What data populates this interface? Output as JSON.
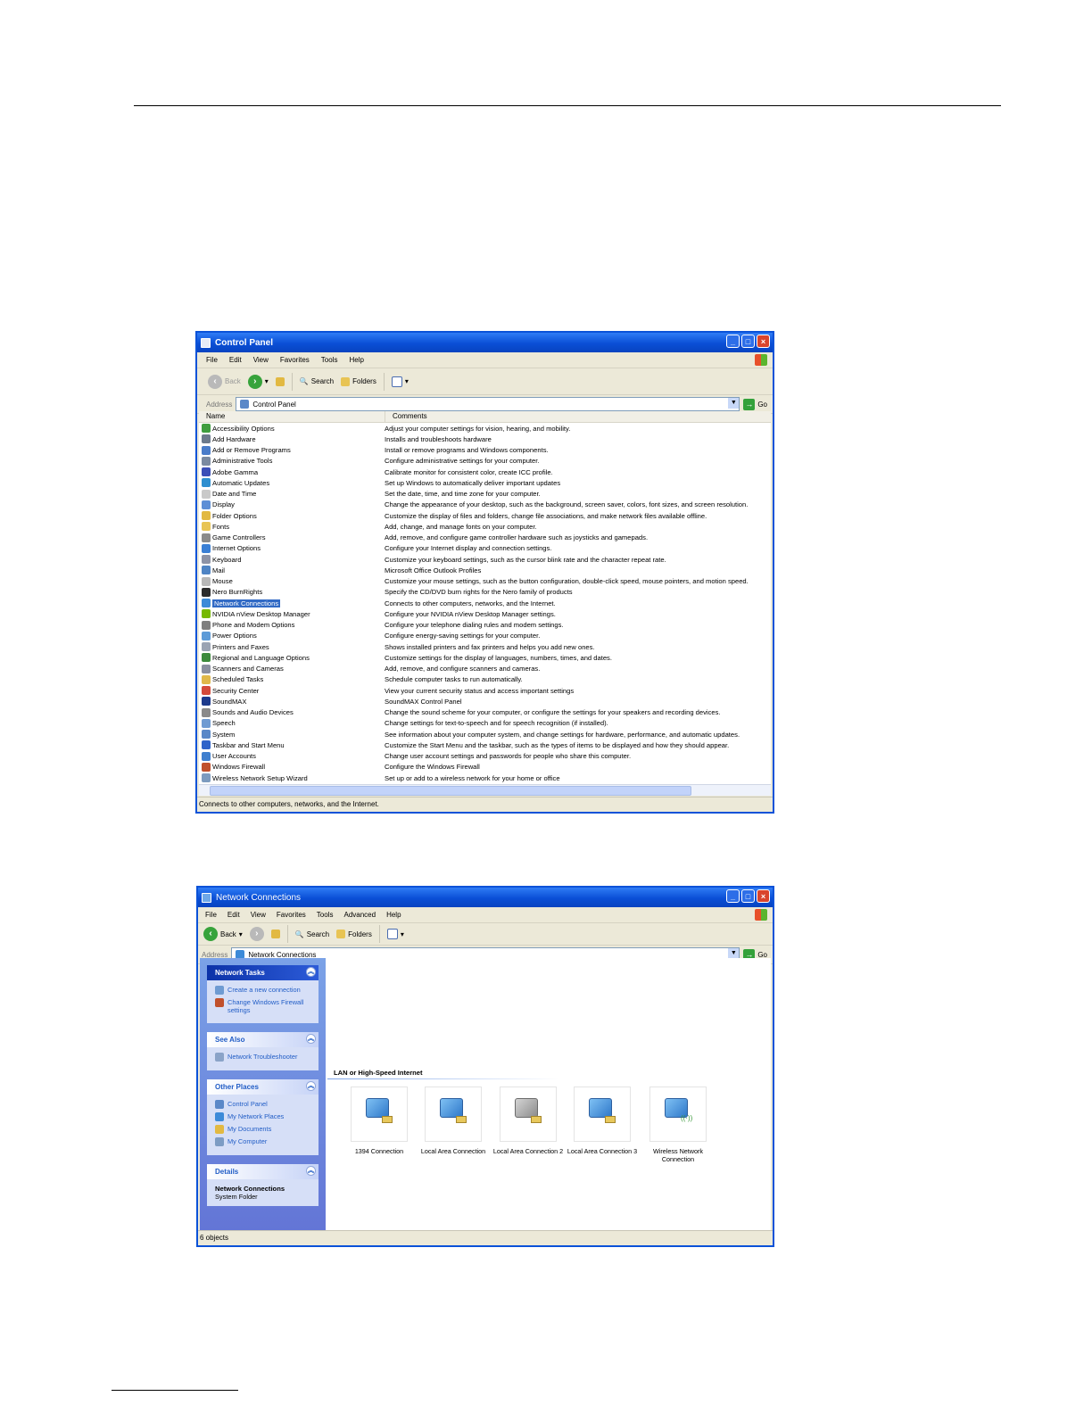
{
  "control_panel": {
    "title": "Control Panel",
    "menu": [
      "File",
      "Edit",
      "View",
      "Favorites",
      "Tools",
      "Help"
    ],
    "toolbar": {
      "back": "Back",
      "search": "Search",
      "folders": "Folders"
    },
    "address_label": "Address",
    "address_value": "Control Panel",
    "go": "Go",
    "columns": {
      "name": "Name",
      "comments": "Comments"
    },
    "items": [
      {
        "name": "Accessibility Options",
        "comment": "Adjust your computer settings for vision, hearing, and mobility.",
        "color": "#3f9d3f"
      },
      {
        "name": "Add Hardware",
        "comment": "Installs and troubleshoots hardware",
        "color": "#6c7a8c"
      },
      {
        "name": "Add or Remove Programs",
        "comment": "Install or remove programs and Windows components.",
        "color": "#4a7cc9"
      },
      {
        "name": "Administrative Tools",
        "comment": "Configure administrative settings for your computer.",
        "color": "#7b8aa0"
      },
      {
        "name": "Adobe Gamma",
        "comment": "Calibrate monitor for consistent color, create ICC profile.",
        "color": "#3b4fb8"
      },
      {
        "name": "Automatic Updates",
        "comment": "Set up Windows to automatically deliver important updates",
        "color": "#2f8fd0"
      },
      {
        "name": "Date and Time",
        "comment": "Set the date, time, and time zone for your computer.",
        "color": "#c9c9c9"
      },
      {
        "name": "Display",
        "comment": "Change the appearance of your desktop, such as the background, screen saver, colors, font sizes, and screen resolution.",
        "color": "#5e8fd6"
      },
      {
        "name": "Folder Options",
        "comment": "Customize the display of files and folders, change file associations, and make network files available offline.",
        "color": "#e2b942"
      },
      {
        "name": "Fonts",
        "comment": "Add, change, and manage fonts on your computer.",
        "color": "#e8c454"
      },
      {
        "name": "Game Controllers",
        "comment": "Add, remove, and configure game controller hardware such as joysticks and gamepads.",
        "color": "#8b8b8b"
      },
      {
        "name": "Internet Options",
        "comment": "Configure your Internet display and connection settings.",
        "color": "#3a7fd5"
      },
      {
        "name": "Keyboard",
        "comment": "Customize your keyboard settings, such as the cursor blink rate and the character repeat rate.",
        "color": "#8d93a6"
      },
      {
        "name": "Mail",
        "comment": "Microsoft Office Outlook Profiles",
        "color": "#4f84c4"
      },
      {
        "name": "Mouse",
        "comment": "Customize your mouse settings, such as the button configuration, double-click speed, mouse pointers, and motion speed.",
        "color": "#b8b8b8"
      },
      {
        "name": "Nero BurnRights",
        "comment": "Specify the CD/DVD burn rights for the Nero family of products",
        "color": "#2b2b2b"
      },
      {
        "name": "Network Connections",
        "comment": "Connects to other computers, networks, and the Internet.",
        "color": "#3c8ad8",
        "selected": true
      },
      {
        "name": "NVIDIA nView Desktop Manager",
        "comment": "Configure your NVIDIA nView Desktop Manager settings.",
        "color": "#76b900"
      },
      {
        "name": "Phone and Modem Options",
        "comment": "Configure your telephone dialing rules and modem settings.",
        "color": "#7f7f7f"
      },
      {
        "name": "Power Options",
        "comment": "Configure energy-saving settings for your computer.",
        "color": "#5d9bd8"
      },
      {
        "name": "Printers and Faxes",
        "comment": "Shows installed printers and fax printers and helps you add new ones.",
        "color": "#9aa3b3"
      },
      {
        "name": "Regional and Language Options",
        "comment": "Customize settings for the display of languages, numbers, times, and dates.",
        "color": "#3c8a3c"
      },
      {
        "name": "Scanners and Cameras",
        "comment": "Add, remove, and configure scanners and cameras.",
        "color": "#8a8fa0"
      },
      {
        "name": "Scheduled Tasks",
        "comment": "Schedule computer tasks to run automatically.",
        "color": "#e0b84a"
      },
      {
        "name": "Security Center",
        "comment": "View your current security status and access important settings",
        "color": "#d44a3a"
      },
      {
        "name": "SoundMAX",
        "comment": "SoundMAX Control Panel",
        "color": "#1d3a8c"
      },
      {
        "name": "Sounds and Audio Devices",
        "comment": "Change the sound scheme for your computer, or configure the settings for your speakers and recording devices.",
        "color": "#8a8a8a"
      },
      {
        "name": "Speech",
        "comment": "Change settings for text-to-speech and for speech recognition (if installed).",
        "color": "#6f9bd2"
      },
      {
        "name": "System",
        "comment": "See information about your computer system, and change settings for hardware, performance, and automatic updates.",
        "color": "#5a88c8"
      },
      {
        "name": "Taskbar and Start Menu",
        "comment": "Customize the Start Menu and the taskbar, such as the types of items to be displayed and how they should appear.",
        "color": "#2f63c9"
      },
      {
        "name": "User Accounts",
        "comment": "Change user account settings and passwords for people who share this computer.",
        "color": "#3f7fcf"
      },
      {
        "name": "Windows Firewall",
        "comment": "Configure the Windows Firewall",
        "color": "#c0502c"
      },
      {
        "name": "Wireless Network Setup Wizard",
        "comment": "Set up or add to a wireless network for your home or office",
        "color": "#7c9bbf"
      }
    ],
    "status": "Connects to other computers, networks, and the Internet."
  },
  "network_connections": {
    "title": "Network Connections",
    "menu": [
      "File",
      "Edit",
      "View",
      "Favorites",
      "Tools",
      "Advanced",
      "Help"
    ],
    "toolbar": {
      "back": "Back",
      "search": "Search",
      "folders": "Folders"
    },
    "address_label": "Address",
    "address_value": "Network Connections",
    "go": "Go",
    "network_tasks": {
      "title": "Network Tasks",
      "items": [
        "Create a new connection",
        "Change Windows Firewall settings"
      ]
    },
    "see_also": {
      "title": "See Also",
      "items": [
        "Network Troubleshooter"
      ]
    },
    "other_places": {
      "title": "Other Places",
      "items": [
        "Control Panel",
        "My Network Places",
        "My Documents",
        "My Computer"
      ]
    },
    "details": {
      "title": "Details",
      "name": "Network Connections",
      "type": "System Folder"
    },
    "group_header": "LAN or High-Speed Internet",
    "connections": [
      {
        "label": "1394 Connection",
        "state": "on"
      },
      {
        "label": "Local Area Connection",
        "state": "on"
      },
      {
        "label": "Local Area Connection 2",
        "state": "off"
      },
      {
        "label": "Local Area Connection 3",
        "state": "on"
      },
      {
        "label": "Wireless Network Connection",
        "state": "wireless"
      }
    ],
    "status": "6 objects"
  }
}
